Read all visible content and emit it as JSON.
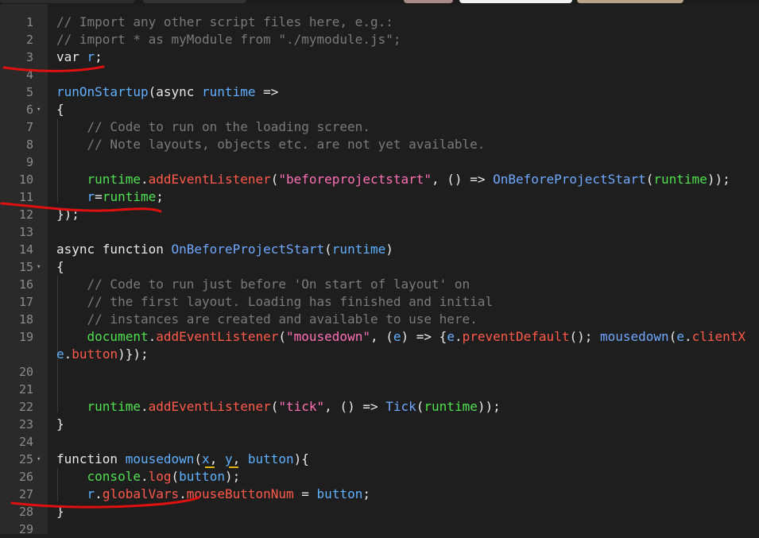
{
  "line_numbers": [
    "1",
    "2",
    "3",
    "4",
    "5",
    "6",
    "7",
    "8",
    "9",
    "10",
    "11",
    "12",
    "13",
    "14",
    "15",
    "16",
    "17",
    "18",
    "19",
    "",
    "20",
    "21",
    "22",
    "23",
    "24",
    "25",
    "26",
    "27",
    "28",
    "29"
  ],
  "fold_marker": "▾",
  "code": {
    "l1": "// Import any other script files here, e.g.:",
    "l2": "// import * as myModule from \"./mymodule.js\";",
    "l3_kw": "var ",
    "l3_var": "r",
    "l3_end": ";",
    "l5_fn": "runOnStartup",
    "l5_mid": "(async ",
    "l5_param": "runtime",
    "l5_end": " =>",
    "brace_open": "{",
    "l7": "// Code to run on the loading screen.",
    "l8": "// Note layouts, objects etc. are not yet available.",
    "l10_obj": "runtime",
    "dot": ".",
    "l10_method": "addEventListener",
    "l10_a": "(",
    "l10_str": "\"beforeprojectstart\"",
    "l10_b": ", () => ",
    "l10_call": "OnBeforeProjectStart",
    "l10_c": "(",
    "l10_arg": "runtime",
    "l10_d": "));",
    "l11_a": "r",
    "l11_b": "=",
    "l11_c": "runtime",
    "l11_d": ";",
    "l12": "});",
    "l14_kw": "async function ",
    "l14_fn": "OnBeforeProjectStart",
    "l14_a": "(",
    "l14_param": "runtime",
    "l14_b": ")",
    "l16": "// Code to run just before 'On start of layout' on",
    "l17": "// the first layout. Loading has finished and initial",
    "l18": "// instances are created and available to use here.",
    "l19_obj": "document",
    "l19_method": "addEventListener",
    "l19_a": "(",
    "l19_str": "\"mousedown\"",
    "l19_b": ", (",
    "l19_e": "e",
    "l19_c": ") => {",
    "l19_e2": "e",
    "l19_method2": "preventDefault",
    "l19_d": "(); ",
    "l19_call": "mousedown",
    "l19_e_open": "(",
    "l19_e3": "e",
    "l19_prop": "clientX",
    "l19w_e": "e",
    "l19w_prop": "button",
    "l19w_end": ")});",
    "l22_obj": "runtime",
    "l22_method": "addEventListener",
    "l22_a": "(",
    "l22_str": "\"tick\"",
    "l22_b": ", () => ",
    "l22_call": "Tick",
    "l22_c": "(",
    "l22_arg": "runtime",
    "l22_d": "));",
    "brace_close": "}",
    "l25_kw": "function ",
    "l25_fn": "mousedown",
    "l25_a": "(",
    "l25_x": "x",
    "l25_sep1": ", ",
    "l25_y": "y",
    "l25_sep2": ", ",
    "l25_btn": "button",
    "l25_b": "){",
    "l26_obj": "console",
    "l26_method": "log",
    "l26_a": "(",
    "l26_arg": "button",
    "l26_b": ");",
    "l27_r": "r",
    "l27_gv": "globalVars",
    "l27_prop": "mouseButtonNum",
    "l27_eq": " = ",
    "l27_val": "button",
    "l27_end": ";",
    "l28": "}"
  },
  "colors": {
    "background": "#1e1e1e",
    "gutter": "#2a2a2a",
    "comment": "#7a7a7a",
    "variable": "#5fb0ff",
    "method": "#ff5a48",
    "string": "#ff6fb4",
    "green": "#4ee04e",
    "annotation": "#e01010"
  }
}
